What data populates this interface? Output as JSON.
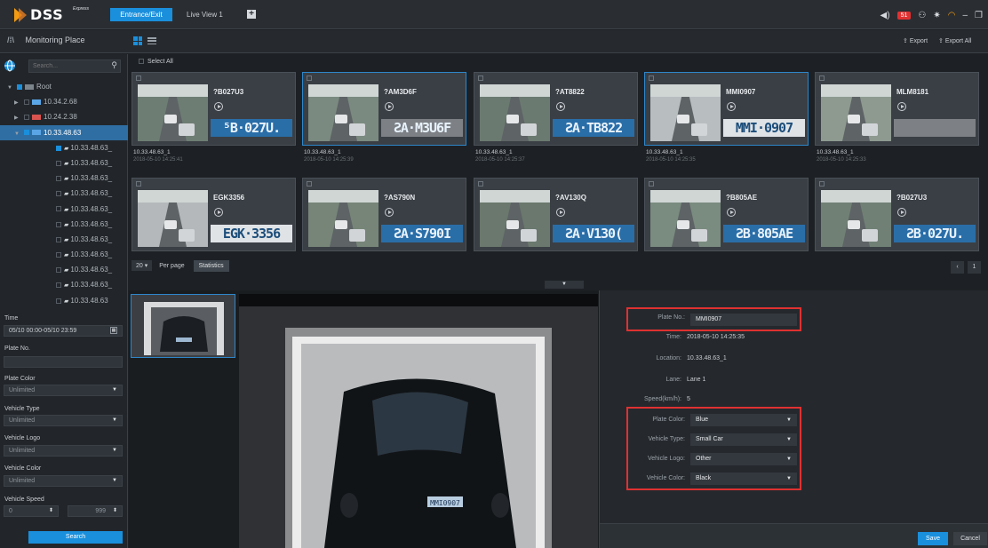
{
  "app": {
    "brand": "DSS",
    "brand_sub": "Express",
    "tabs": [
      {
        "label": "Entrance/Exit"
      },
      {
        "label": "Live View 1"
      }
    ],
    "alarm_count": "51"
  },
  "subbar": {
    "title": "Monitoring Place",
    "export_label": "Export",
    "export_all_label": "Export All"
  },
  "sidebar": {
    "search_placeholder": "Search...",
    "tree": [
      {
        "label": "Root",
        "level": 0
      },
      {
        "label": "10.34.2.68",
        "level": 1
      },
      {
        "label": "10.24.2.38",
        "level": 1
      },
      {
        "label": "10.33.48.63",
        "level": 1
      },
      {
        "label": "10.33.48.63_",
        "level": 2
      },
      {
        "label": "10.33.48.63_",
        "level": 2
      },
      {
        "label": "10.33.48.63_",
        "level": 2
      },
      {
        "label": "10.33.48.63_",
        "level": 2
      },
      {
        "label": "10.33.48.63_",
        "level": 2
      },
      {
        "label": "10.33.48.63_",
        "level": 2
      },
      {
        "label": "10.33.48.63_",
        "level": 2
      },
      {
        "label": "10.33.48.63_",
        "level": 2
      },
      {
        "label": "10.33.48.63_",
        "level": 2
      },
      {
        "label": "10.33.48.63_",
        "level": 2
      },
      {
        "label": "10.33.48.63",
        "level": 2
      }
    ],
    "filters": {
      "time_label": "Time",
      "time_value": "05/10 00:00-05/10 23:59",
      "plate_no_label": "Plate No.",
      "plate_no_value": "",
      "plate_color_label": "Plate Color",
      "plate_color_value": "Unlimited",
      "vehicle_type_label": "Vehicle Type",
      "vehicle_type_value": "Unlimited",
      "vehicle_logo_label": "Vehicle Logo",
      "vehicle_logo_value": "Unlimited",
      "vehicle_color_label": "Vehicle Color",
      "vehicle_color_value": "Unlimited",
      "vehicle_speed_label": "Vehicle Speed",
      "speed_min": "0",
      "speed_max": "999",
      "search_button": "Search"
    }
  },
  "grid": {
    "select_all": "Select All",
    "cards": [
      {
        "plate": "?B027U3",
        "plate_img": "⁵B·027U.",
        "style": "blue",
        "location": "10.33.48.63_1",
        "time": "2018-05-10 14:25:41"
      },
      {
        "plate": "?AM3D6F",
        "plate_img": "ƧA·M3U6F",
        "style": "gray",
        "location": "10.33.48.63_1",
        "time": "2018-05-10 14:25:39"
      },
      {
        "plate": "?AT8822",
        "plate_img": "ƧA·TB822",
        "style": "blue",
        "location": "10.33.48.63_1",
        "time": "2018-05-10 14:25:37"
      },
      {
        "plate": "MMI0907",
        "plate_img": "MMI·0907",
        "style": "white",
        "location": "10.33.48.63_1",
        "time": "2018-05-10 14:25:35"
      },
      {
        "plate": "MLM8181",
        "plate_img": "",
        "style": "gray",
        "location": "10.33.48.63_1",
        "time": "2018-05-10 14:25:33"
      },
      {
        "plate": "EGK3356",
        "plate_img": "EGK·3356",
        "style": "white",
        "location": "",
        "time": ""
      },
      {
        "plate": "?AS790N",
        "plate_img": "ƧA·S790I",
        "style": "blue",
        "location": "",
        "time": ""
      },
      {
        "plate": "?AV130Q",
        "plate_img": "ƧA·V130(",
        "style": "blue",
        "location": "",
        "time": ""
      },
      {
        "plate": "?B805AE",
        "plate_img": "ƧB·805AE",
        "style": "blue",
        "location": "",
        "time": ""
      },
      {
        "plate": "?B027U3",
        "plate_img": "ƧB·027U.",
        "style": "blue",
        "location": "",
        "time": ""
      }
    ],
    "per_page_value": "20",
    "per_page_label": "Per page",
    "statistics_label": "Statistics",
    "page_number": "1"
  },
  "detail": {
    "plate_label": "Plate No.:",
    "plate_value": "MMI0907",
    "time_label": "Time:",
    "time_value": "2018-05-10 14:25:35",
    "location_label": "Location:",
    "location_value": "10.33.48.63_1",
    "lane_label": "Lane:",
    "lane_value": "Lane 1",
    "speed_label": "Speed(km/h):",
    "speed_value": "5",
    "plate_color_label": "Plate Color:",
    "plate_color_value": "Blue",
    "vehicle_type_label": "Vehicle Type:",
    "vehicle_type_value": "Small Car",
    "vehicle_logo_label": "Vehicle Logo:",
    "vehicle_logo_value": "Other",
    "vehicle_color_label": "Vehicle Color:",
    "vehicle_color_value": "Black",
    "photo_plate": "MMI0907",
    "save_label": "Save",
    "cancel_label": "Cancel"
  },
  "colors": {
    "accent": "#1a8fdc",
    "highlight_border": "#e03131",
    "background": "#1d2125"
  }
}
